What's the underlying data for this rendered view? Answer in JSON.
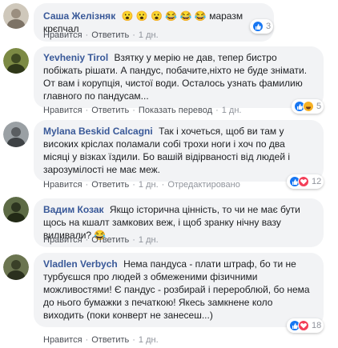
{
  "comments": [
    {
      "author": "Саша Желізняк",
      "text": "😮 😮 😮 😂 😂 😂 маразм крєпчал",
      "actions": [
        "Нравится",
        "Ответить",
        "1 дн."
      ],
      "reaction_count": "3",
      "avatar_color": "#c8c1b4"
    },
    {
      "author": "Yevheniy Tirol",
      "text": "Взятку у мерію не дав, тепер бистро побіжать рішати. А пандус, побачите,ніхто не буде знімати. От вам і корупція, чистої води. Осталось узнать фамилию главного по пандусам...",
      "actions": [
        "Нравится",
        "Ответить",
        "Показать перевод",
        "1 дн."
      ],
      "reaction_count": "5",
      "avatar_color": "#6e7a3a"
    },
    {
      "author": "Mylana Beskid Calcagni",
      "text": "Так і хочеться, щоб ви там у високих кріслах поламали собі трохи ноги і хоч по два місяці у візках їздили. Бо вашій відірваності від людей і зарозумілості не має меж.",
      "actions": [
        "Нравится",
        "Ответить",
        "1 дн.",
        "Отредактировано"
      ],
      "reaction_count": "12",
      "avatar_color": "#8a8f93"
    },
    {
      "author": "Вадим Козак",
      "text": "Якщо історична цінність, то чи не має бути щось на кшалт замкових веж, і щоб зранку нічну вазу виливали? 😂",
      "actions": [
        "Нравится",
        "Ответить",
        "1 дн."
      ],
      "reaction_count": "",
      "avatar_color": "#4d5a3b"
    },
    {
      "author": "Vladlen Verbych",
      "text": "Нема пандуса - плати штраф, бо ти не турбуєшся про людей з обмеженими фізичними можливостями! Є пандус - розбирай і перероблюй, бо нема до нього бумажки з печаткою! Якесь замкнене коло виходить (поки конверт не занесеш...)",
      "actions": [
        "Нравится",
        "Ответить",
        "1 дн."
      ],
      "reaction_count": "18",
      "avatar_color": "#5f6a45"
    }
  ],
  "colors": {
    "author": "#385898",
    "bubble": "#f2f3f5",
    "meta": "#90949c",
    "like": "#1877f2",
    "heart": "#f33e58",
    "haha": "#f7b125"
  }
}
